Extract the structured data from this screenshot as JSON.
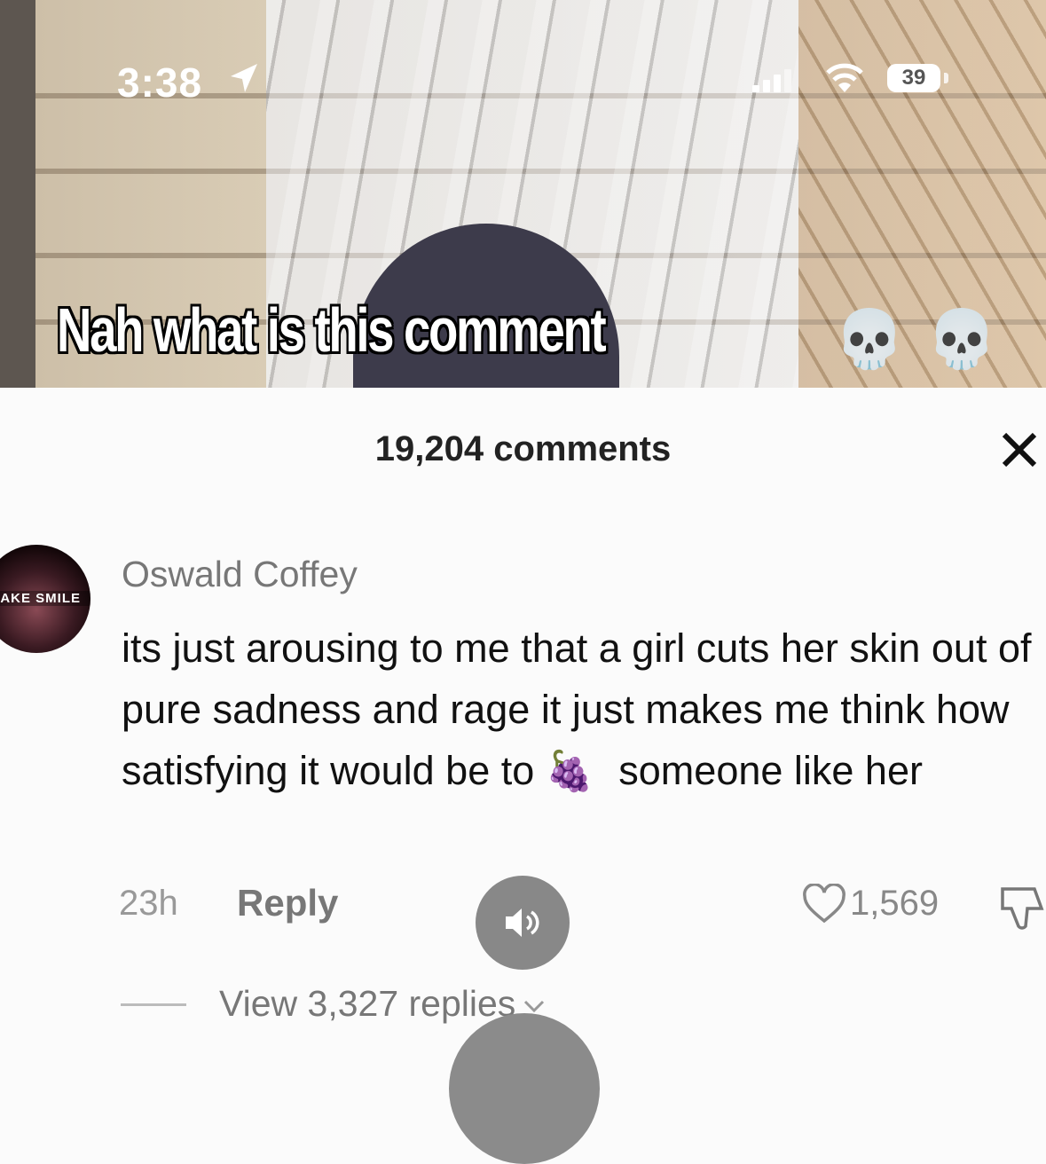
{
  "status_bar": {
    "time": "3:38",
    "battery": "39"
  },
  "video": {
    "caption": "Nah what is this comment",
    "caption_emoji": "💀"
  },
  "comments_panel": {
    "count_label": "19,204 comments",
    "close_icon": "close-icon"
  },
  "comment": {
    "avatar_text": "FAKE SMILE",
    "username": "Oswald Coffey",
    "text_before_emoji": "its just arousing to me that a girl cuts her skin out of pure sadness and rage it just makes me think how satisfying it would be to",
    "emoji": "🍇",
    "text_after_emoji": "someone like her",
    "time": "23h",
    "reply_label": "Reply",
    "like_count": "1,569",
    "view_replies_label": "View 3,327 replies"
  },
  "colors": {
    "background": "#fbfbfb",
    "sound_button": "#888888"
  }
}
